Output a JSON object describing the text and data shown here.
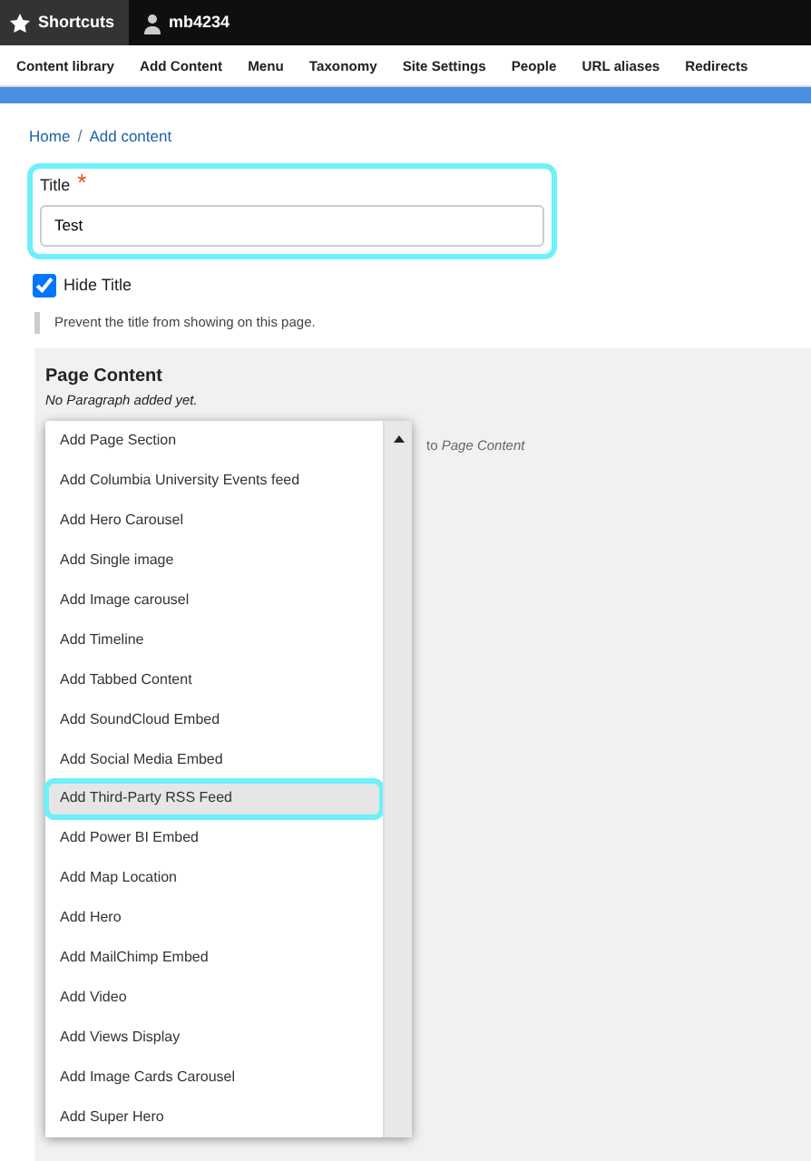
{
  "toolbar": {
    "shortcuts": "Shortcuts",
    "user": "mb4234"
  },
  "menu": [
    "Content library",
    "Add Content",
    "Menu",
    "Taxonomy",
    "Site Settings",
    "People",
    "URL aliases",
    "Redirects"
  ],
  "breadcrumb": [
    "Home",
    "Add content"
  ],
  "breadcrumb_separator": "/",
  "title_field": {
    "label": "Title",
    "required_marker": "*",
    "value": "Test"
  },
  "hide_title": {
    "label": "Hide Title",
    "checked": true,
    "description": "Prevent the title from showing on this page."
  },
  "page_content": {
    "heading": "Page Content",
    "empty_text": "No Paragraph added yet.",
    "to_text": "to",
    "target": "Page Content"
  },
  "dropdown": [
    {
      "label": "Add Page Section",
      "selected": false
    },
    {
      "label": "Add Columbia University Events feed",
      "selected": false
    },
    {
      "label": "Add Hero Carousel",
      "selected": false
    },
    {
      "label": "Add Single image",
      "selected": false
    },
    {
      "label": "Add Image carousel",
      "selected": false
    },
    {
      "label": "Add Timeline",
      "selected": false
    },
    {
      "label": "Add Tabbed Content",
      "selected": false
    },
    {
      "label": "Add SoundCloud Embed",
      "selected": false
    },
    {
      "label": "Add Social Media Embed",
      "selected": false
    },
    {
      "label": "Add Third-Party RSS Feed",
      "selected": true
    },
    {
      "label": "Add Power BI Embed",
      "selected": false
    },
    {
      "label": "Add Map Location",
      "selected": false
    },
    {
      "label": "Add Hero",
      "selected": false
    },
    {
      "label": "Add MailChimp Embed",
      "selected": false
    },
    {
      "label": "Add Video",
      "selected": false
    },
    {
      "label": "Add Views Display",
      "selected": false
    },
    {
      "label": "Add Image Cards Carousel",
      "selected": false
    },
    {
      "label": "Add Super Hero",
      "selected": false
    }
  ]
}
